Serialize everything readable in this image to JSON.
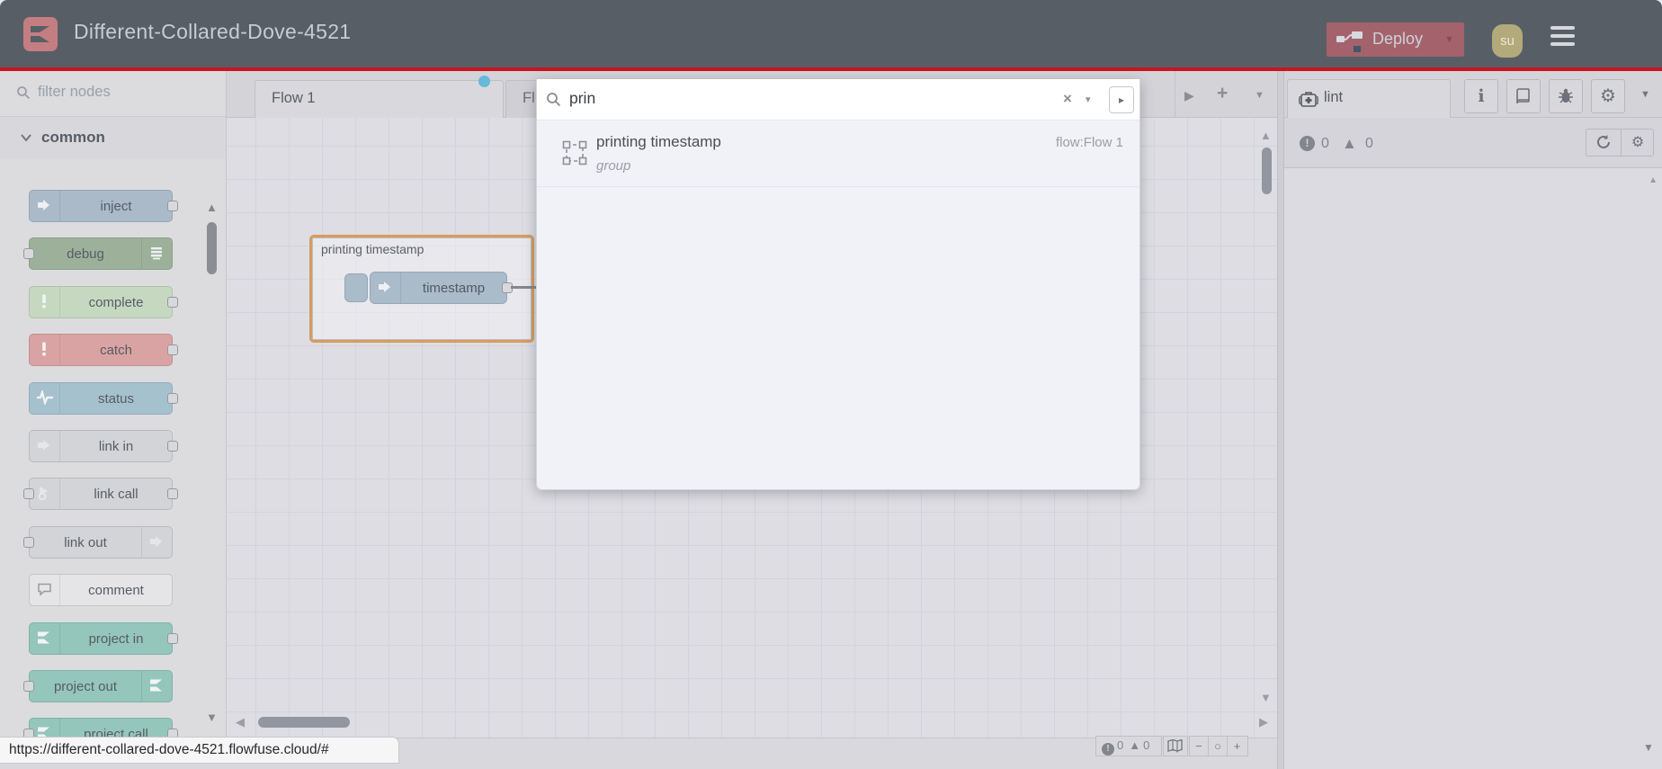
{
  "header": {
    "title": "Different-Collared-Dove-4521",
    "deploy_label": "Deploy",
    "avatar_label": "su"
  },
  "palette": {
    "filter_placeholder": "filter nodes",
    "category_label": "common",
    "nodes": [
      {
        "label": "inject",
        "bg": "#aabac9",
        "border": "#96a6b5",
        "icon": "arrow",
        "side": "l",
        "ports": "r"
      },
      {
        "label": "debug",
        "bg": "#9db19a",
        "border": "#8aa089",
        "icon": "lines",
        "side": "r",
        "ports": "l"
      },
      {
        "label": "complete",
        "bg": "#c6d9c0",
        "border": "#aec3a8",
        "icon": "exclaim",
        "side": "l",
        "ports": "r"
      },
      {
        "label": "catch",
        "bg": "#daa3a3",
        "border": "#c48f8f",
        "icon": "exclaim",
        "side": "l",
        "ports": "r"
      },
      {
        "label": "status",
        "bg": "#a6c1ce",
        "border": "#92aebc",
        "icon": "pulse",
        "side": "l",
        "ports": "r"
      },
      {
        "label": "link in",
        "bg": "#d3d4d7",
        "border": "#b9babf",
        "icon": "linkarrow",
        "side": "l",
        "ports": "r"
      },
      {
        "label": "link call",
        "bg": "#d3d4d7",
        "border": "#b9babf",
        "icon": "linkcall",
        "side": "l",
        "ports": "lr"
      },
      {
        "label": "link out",
        "bg": "#d3d4d7",
        "border": "#b9babf",
        "icon": "linkarrow",
        "side": "r",
        "ports": "l"
      },
      {
        "label": "comment",
        "bg": "#e5e5e8",
        "border": "#c4c4c9",
        "icon": "bubble",
        "side": "l",
        "ports": ""
      },
      {
        "label": "project in",
        "bg": "#94c6bb",
        "border": "#7fb3a8",
        "icon": "logo",
        "side": "l",
        "ports": "r"
      },
      {
        "label": "project out",
        "bg": "#94c6bb",
        "border": "#7fb3a8",
        "icon": "logo",
        "side": "r",
        "ports": "l"
      },
      {
        "label": "project call",
        "bg": "#94c6bb",
        "border": "#7fb3a8",
        "icon": "logo",
        "side": "l",
        "ports": "lr"
      }
    ]
  },
  "tabs": {
    "tab1_label": "Flow 1",
    "tab2_label": "Fl"
  },
  "canvas": {
    "group_label": "printing timestamp",
    "node_label": "timestamp"
  },
  "search": {
    "query": "prin",
    "result_title": "printing timestamp",
    "result_flow": "flow:Flow 1",
    "result_type": "group"
  },
  "sidebar": {
    "tab_label": "lint",
    "error_count": "0",
    "warning_count": "0"
  },
  "footer": {
    "error_count": "0",
    "warning_count": "0",
    "url": "https://different-collared-dove-4521.flowfuse.cloud/#"
  },
  "icons": {
    "caret_down": "▼",
    "caret_down_small": "▾",
    "caret_right_small": "▸",
    "scroll_up": "▲",
    "scroll_down": "▼",
    "scroll_left": "◀",
    "scroll_right": "▶",
    "plus": "+",
    "minus": "−",
    "zoom_reset": "○",
    "close": "×",
    "warning_triangle": "▲",
    "exclaim": "!",
    "info": "i",
    "gear": "⚙"
  },
  "colors": {
    "header_bg": "#585e66",
    "accent_red": "#c6161e",
    "deploy_bg": "#a4636c",
    "logo_bg": "#c47e82",
    "group_border": "#d69d5e",
    "tab_dot_blue": "#67b8db",
    "canvas_bg": "#dddde3"
  }
}
